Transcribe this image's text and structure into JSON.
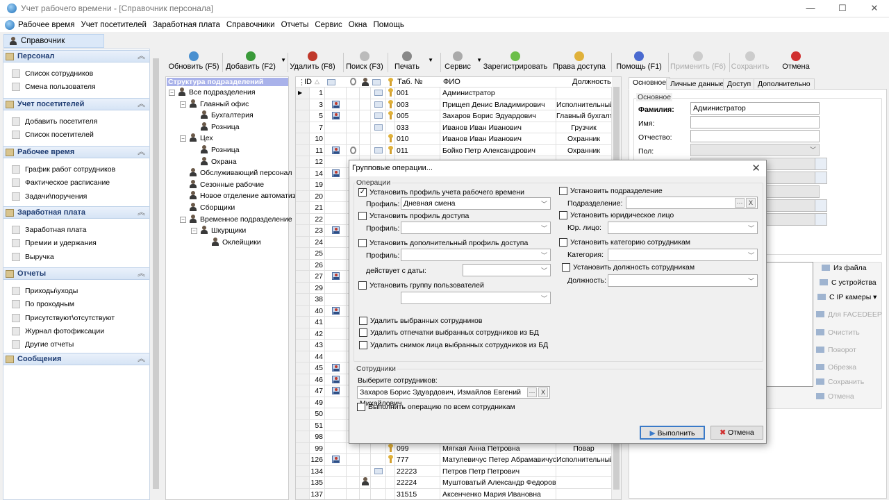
{
  "window": {
    "title": "Учет рабочего времени - [Справочник персонала]",
    "controls": [
      "—",
      "☐",
      "✕"
    ]
  },
  "menu": [
    "Рабочее время",
    "Учет посетителей",
    "Заработная плата",
    "Справочники",
    "Отчеты",
    "Сервис",
    "Окна",
    "Помощь"
  ],
  "doc_tab": "Справочник персонала",
  "sidebar": {
    "sections": [
      {
        "title": "Персонал",
        "items": [
          "Список сотрудников",
          "Смена пользователя"
        ]
      },
      {
        "title": "Учет посетителей",
        "items": [
          "Добавить посетителя",
          "Список посетителей"
        ]
      },
      {
        "title": "Рабочее время",
        "items": [
          "График работ сотрудников",
          "Фактическое расписание",
          "Задачи\\поручения"
        ]
      },
      {
        "title": "Заработная плата",
        "items": [
          "Заработная плата",
          "Премии и удержания",
          "Выручка"
        ]
      },
      {
        "title": "Отчеты",
        "items": [
          "Приходы\\уходы",
          "По проходным",
          "Присутствуют\\отсутствуют",
          "Журнал фотофиксации",
          "Другие отчеты"
        ]
      },
      {
        "title": "Сообщения",
        "items": []
      }
    ]
  },
  "toolbar": [
    {
      "label": "Обновить (F5)",
      "icon": "refresh-icon",
      "color": "#4a90d0",
      "enabled": true
    },
    {
      "label": "Добавить (F2)",
      "icon": "add-user-icon",
      "color": "#3a9a3a",
      "enabled": true,
      "dropdown": true
    },
    {
      "label": "Удалить (F8)",
      "icon": "delete-user-icon",
      "color": "#c0392b",
      "enabled": true
    },
    {
      "label": "Поиск (F3)",
      "icon": "search-icon",
      "color": "#bbbbbb",
      "enabled": true
    },
    {
      "label": "Печать",
      "icon": "print-icon",
      "color": "#888888",
      "enabled": true,
      "dropdown": true
    },
    {
      "label": "Сервис",
      "icon": "gear-icon",
      "color": "#aaaaaa",
      "enabled": true,
      "dropdown": true
    },
    {
      "label": "Зарегистрировать",
      "icon": "fingerprint-icon",
      "color": "#6cbf4a",
      "enabled": true
    },
    {
      "label": "Права доступа",
      "icon": "key-icon",
      "color": "#e0b13a",
      "enabled": true
    },
    {
      "label": "Помощь (F1)",
      "icon": "help-icon",
      "color": "#4a6ad0",
      "enabled": true
    },
    {
      "label": "Применить (F6)",
      "icon": "apply-icon",
      "color": "#cccccc",
      "enabled": false
    },
    {
      "label": "Сохранить",
      "icon": "check-icon",
      "color": "#cccccc",
      "enabled": false
    },
    {
      "label": "Отмена",
      "icon": "cancel-icon",
      "color": "#d03030",
      "enabled": true
    }
  ],
  "tree": {
    "header": "Структура подразделений",
    "nodes": [
      {
        "label": "Все подразделения",
        "level": 0,
        "expand": true
      },
      {
        "label": "Главный офис",
        "level": 1,
        "expand": true
      },
      {
        "label": "Бухгалтерия",
        "level": 2
      },
      {
        "label": "Розница",
        "level": 2
      },
      {
        "label": "Цех",
        "level": 1,
        "expand": true
      },
      {
        "label": "Розница",
        "level": 2
      },
      {
        "label": "Охрана",
        "level": 2
      },
      {
        "label": "Обслуживающий персонал",
        "level": 1
      },
      {
        "label": "Сезонные рабочие",
        "level": 1
      },
      {
        "label": "Новое отделение автоматиз",
        "level": 1
      },
      {
        "label": "Сборщики",
        "level": 1
      },
      {
        "label": "Временное подразделение",
        "level": 1,
        "expand": true
      },
      {
        "label": "Шкурщики",
        "level": 2,
        "expand": true
      },
      {
        "label": "Оклейщики",
        "level": 3
      }
    ]
  },
  "grid": {
    "columns": {
      "id": "ID",
      "tab": "Таб. №",
      "fio": "ФИО",
      "position": "Должность"
    },
    "rows": [
      {
        "id": "1",
        "photo": false,
        "finger": false,
        "person": false,
        "card": true,
        "key": true,
        "tab": "001",
        "fio": "Администратор",
        "position": "",
        "current": true
      },
      {
        "id": "3",
        "photo": true,
        "card": true,
        "key": true,
        "tab": "003",
        "fio": "Прищеп Денис Владимирович",
        "position": "Исполнительный"
      },
      {
        "id": "5",
        "photo": true,
        "card": true,
        "key": true,
        "tab": "005",
        "fio": "Захаров Борис Эдуардович",
        "position": "Главный бухгалт"
      },
      {
        "id": "7",
        "card": true,
        "tab": "033",
        "fio": "Иванов Иван Иванович",
        "position": "Грузчик"
      },
      {
        "id": "10",
        "key": true,
        "tab": "010",
        "fio": "Иванов Иван Иванович",
        "position": "Охранник"
      },
      {
        "id": "11",
        "photo": true,
        "finger": true,
        "card": true,
        "key": true,
        "tab": "011",
        "fio": "Бойко Петр Александрович",
        "position": "Охранник"
      },
      {
        "id": "12"
      },
      {
        "id": "14",
        "photo": true
      },
      {
        "id": "19"
      },
      {
        "id": "20"
      },
      {
        "id": "21"
      },
      {
        "id": "22"
      },
      {
        "id": "23",
        "photo": true
      },
      {
        "id": "24"
      },
      {
        "id": "25"
      },
      {
        "id": "26"
      },
      {
        "id": "27",
        "photo": true
      },
      {
        "id": "29"
      },
      {
        "id": "38"
      },
      {
        "id": "40",
        "photo": true
      },
      {
        "id": "41"
      },
      {
        "id": "42"
      },
      {
        "id": "43"
      },
      {
        "id": "44"
      },
      {
        "id": "45",
        "photo": true
      },
      {
        "id": "46",
        "photo": true
      },
      {
        "id": "47",
        "photo": true
      },
      {
        "id": "49"
      },
      {
        "id": "50"
      },
      {
        "id": "51"
      },
      {
        "id": "98"
      },
      {
        "id": "99",
        "key": true,
        "tab": "099",
        "fio": "Мягкая Анна Петровна",
        "position": "Повар"
      },
      {
        "id": "126",
        "photo": true,
        "key": true,
        "tab": "777",
        "fio": "Матулевичус Петер Абрамавичус",
        "position": "Исполнительный"
      },
      {
        "id": "134",
        "card": true,
        "tab": "22223",
        "fio": "Петров Петр Петрович",
        "position": ""
      },
      {
        "id": "135",
        "person": true,
        "tab": "22224",
        "fio": "Муштоватый Александр Федорович",
        "position": ""
      },
      {
        "id": "137",
        "tab": "31515",
        "fio": "Аксенченко Мария Ивановна",
        "position": ""
      }
    ]
  },
  "details": {
    "tabs": [
      "Основное",
      "Личные данные",
      "Доступ",
      "Дополнительно"
    ],
    "active_tab": 0,
    "group": "Основное",
    "fields": [
      {
        "label": "Фамилия:",
        "value": "Администратор",
        "bold": true
      },
      {
        "label": "Имя:",
        "value": ""
      },
      {
        "label": "Отчество:",
        "value": ""
      },
      {
        "label": "Пол:",
        "value": "",
        "select": true
      }
    ],
    "photo_buttons": [
      {
        "label": "Из файла",
        "enabled": true
      },
      {
        "label": "С устройства",
        "enabled": true
      },
      {
        "label": "С IP камеры ▾",
        "enabled": true
      },
      {
        "label": "Для FACEDEEP",
        "enabled": false
      },
      {
        "label": "Очистить",
        "enabled": false
      },
      {
        "label": "Поворот",
        "enabled": false
      },
      {
        "label": "Обрезка",
        "enabled": false
      },
      {
        "label": "Сохранить",
        "enabled": false
      },
      {
        "label": "Отмена",
        "enabled": false
      }
    ]
  },
  "dialog": {
    "title": "Групповые операции...",
    "close": "✕",
    "operations_label": "Операции",
    "set_time_profile": {
      "label": "Установить профиль учета рабочего времени",
      "checked": true,
      "field_label": "Профиль:",
      "value": "Дневная смена"
    },
    "set_access_profile": {
      "label": "Установить профиль доступа",
      "checked": false,
      "field_label": "Профиль:",
      "value": ""
    },
    "set_extra_profile": {
      "label": "Установить дополнительный профиль доступа",
      "checked": false,
      "field_label": "Профиль:",
      "value": "",
      "date_label": "действует с даты:",
      "date": ""
    },
    "set_user_group": {
      "label": "Установить группу пользователей",
      "checked": false,
      "value": ""
    },
    "set_department": {
      "label": "Установить подразделение",
      "checked": false,
      "field_label": "Подразделение:",
      "value": ""
    },
    "set_legal": {
      "label": "Установить юридическое лицо",
      "checked": false,
      "field_label": "Юр. лицо:",
      "value": ""
    },
    "set_category": {
      "label": "Установить категорию сотрудникам",
      "checked": false,
      "field_label": "Категория:",
      "value": ""
    },
    "set_position": {
      "label": "Установить должность сотрудникам",
      "checked": false,
      "field_label": "Должность:",
      "value": ""
    },
    "delete_employees": {
      "label": "Удалить выбранных сотрудников",
      "checked": false
    },
    "delete_prints": {
      "label": "Удалить отпечатки выбранных сотрудников  из БД",
      "checked": false
    },
    "delete_face": {
      "label": "Удалить снимок лица выбранных сотрудников  из БД",
      "checked": false
    },
    "employees_label": "Сотрудники",
    "select_label": "Выберите сотрудников:",
    "selected": "Захаров Борис Эдуардович, Измайлов Евгений Михайлович",
    "all_employees": {
      "label": "Выполнить операцию по всем сотрудникам",
      "checked": false
    },
    "execute": "Выполнить",
    "cancel": "Отмена"
  }
}
